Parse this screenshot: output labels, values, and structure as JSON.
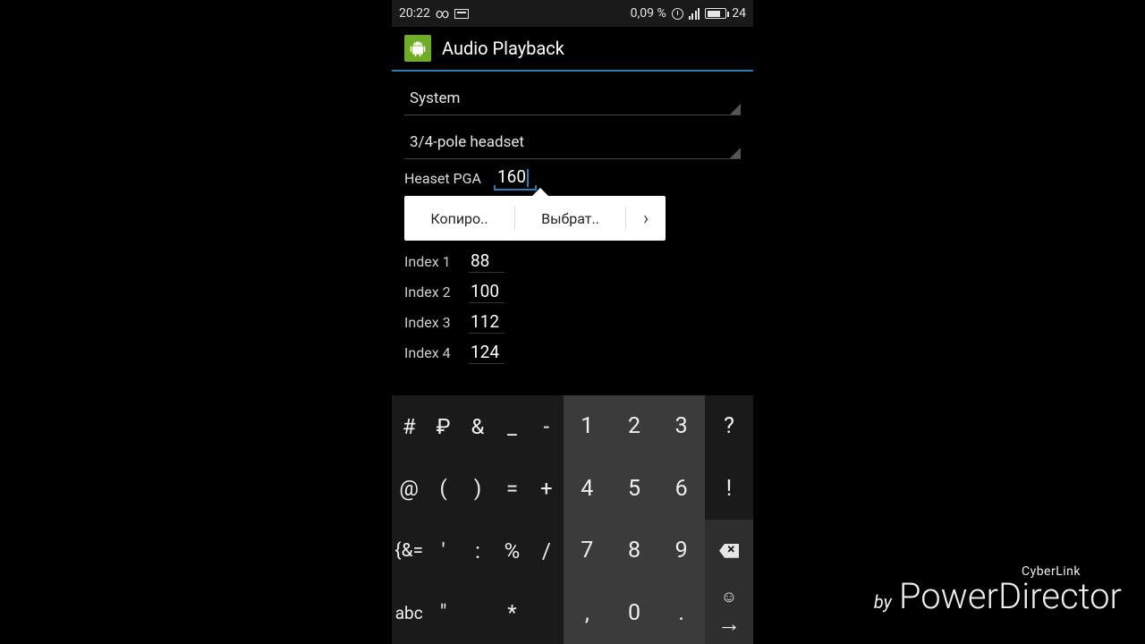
{
  "statusbar": {
    "time": "20:22",
    "data_speed": "0,09 %",
    "battery_pct": "24"
  },
  "app": {
    "title": "Audio Playback"
  },
  "spinners": {
    "profile": "System",
    "device": "3/4-pole headset"
  },
  "headset": {
    "label": "Heaset PGA",
    "value": "160"
  },
  "context": {
    "copy": "Копиро..",
    "select": "Выбрат..",
    "more": "›"
  },
  "indices": [
    {
      "label": "Index 1",
      "value": "88"
    },
    {
      "label": "Index 2",
      "value": "100"
    },
    {
      "label": "Index 3",
      "value": "112"
    },
    {
      "label": "Index 4",
      "value": "124"
    }
  ],
  "keyboard": {
    "symA": [
      [
        "#",
        "₽",
        "&",
        "_",
        "-"
      ],
      [
        "@",
        "(",
        ")",
        "=",
        "+"
      ],
      [
        "{&=",
        "'",
        ":",
        "%",
        "/"
      ],
      [
        "abc",
        "\"",
        "",
        "*",
        ""
      ]
    ],
    "nums": [
      [
        "1",
        "2",
        "3"
      ],
      [
        "4",
        "5",
        "6"
      ],
      [
        "7",
        "8",
        "9"
      ],
      [
        ",",
        "0",
        "."
      ]
    ],
    "side": [
      "?",
      "!",
      "bksp",
      "enter"
    ]
  },
  "watermark": {
    "brand": "CyberLink",
    "by": "by",
    "product": "PowerDirector"
  }
}
